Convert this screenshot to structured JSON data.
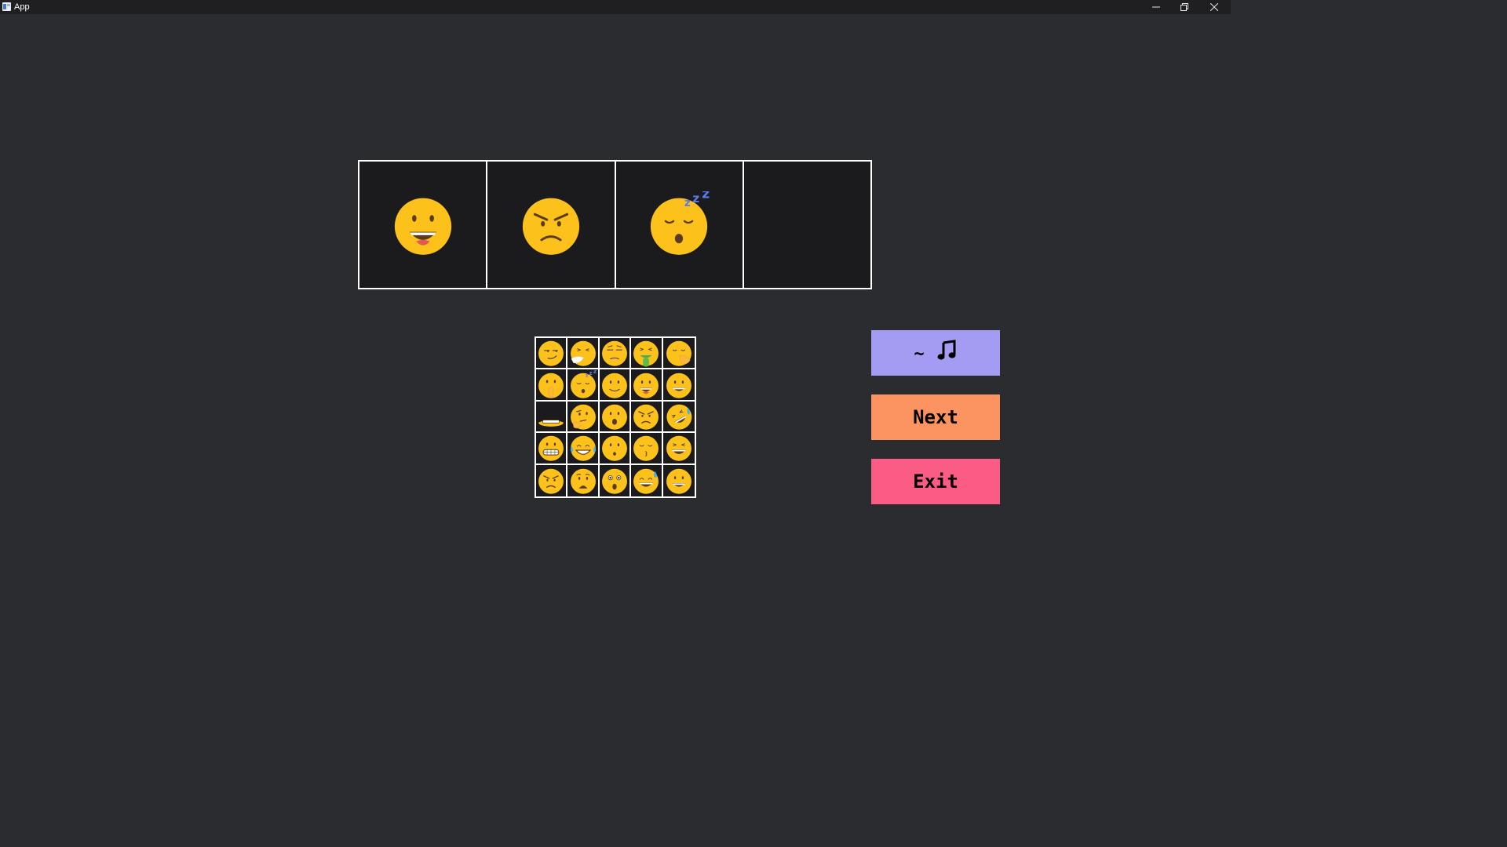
{
  "window": {
    "title": "App",
    "controls": [
      "minimize-icon",
      "restore-icon",
      "close-icon"
    ]
  },
  "sequence": [
    {
      "emoji": "grinning-face-big-eyes"
    },
    {
      "emoji": "angry-face"
    },
    {
      "emoji": "sleeping-face"
    },
    {
      "emoji": ""
    }
  ],
  "picker": [
    "smirking-face",
    "sneezing-face",
    "unamused-face",
    "vomiting-face",
    "face-with-hand-over-mouth",
    "shushing-face",
    "sleeping-face",
    "slightly-smiling-face",
    "grinning-face-big-eyes",
    "grinning-face",
    "melting-grimacing-face",
    "thinking-face",
    "face-with-open-mouth",
    "angry-face",
    "rolling-on-floor-laughing",
    "grimacing-face",
    "face-with-tears-of-joy",
    "hushed-face",
    "kissing-face",
    "grinning-squinting-face",
    "angry-face",
    "anguished-face",
    "astonished-face",
    "grinning-face-with-sweat",
    "grinning-face"
  ],
  "buttons": {
    "music": {
      "prefix": "~",
      "icon": "music-note-icon"
    },
    "next": "Next",
    "exit": "Exit"
  },
  "colors": {
    "background": "#2b2c30",
    "titlebar": "#1f1f21",
    "music_button": "#a49cf3",
    "next_button": "#fb9460",
    "exit_button": "#fb5c86",
    "emoji_yellow": "#fcc21b"
  }
}
